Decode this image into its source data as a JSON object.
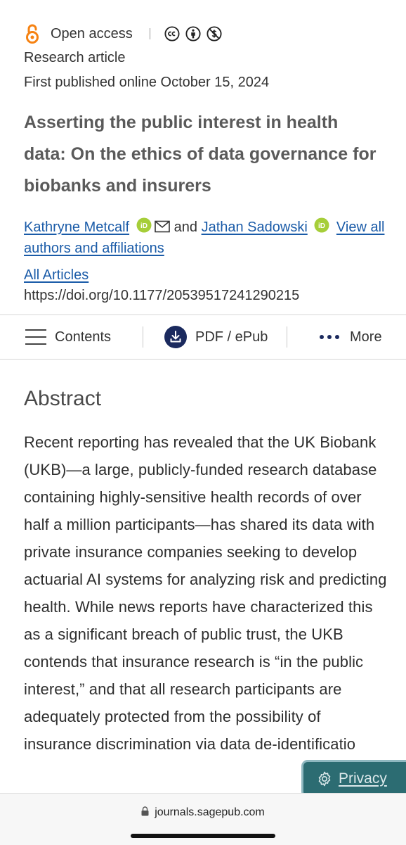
{
  "meta": {
    "access_label": "Open access",
    "license_icons": [
      "cc-icon",
      "attribution-icon",
      "noncommercial-icon"
    ],
    "article_type": "Research article",
    "published": "First published online October 15, 2024"
  },
  "article": {
    "title": "Asserting the public interest in health data: On the ethics of data governance for biobanks and insurers",
    "authors": [
      {
        "name": "Kathryne Metcalf"
      },
      {
        "name": "Jathan Sadowski"
      }
    ],
    "and_word": "and",
    "view_all_label": "View all authors and affiliations",
    "all_articles_label": "All Articles",
    "doi": "https://doi.org/10.1177/20539517241290215"
  },
  "toolbar": {
    "contents_label": "Contents",
    "pdf_label": "PDF / ePub",
    "more_label": "More"
  },
  "abstract": {
    "heading": "Abstract",
    "text": "Recent reporting has revealed that the UK Biobank (UKB)—a large, publicly-funded research database containing highly-sensitive health records of over half a million participants—has shared its data with private insurance companies seeking to develop actuarial AI systems for analyzing risk and predicting health. While news reports have characterized this as a significant breach of public trust, the UKB contends that insurance research is “in the public interest,” and that all research participants are adequately protected from the possibility of insurance discrimination via data de-identificatio"
  },
  "privacy": {
    "label": "Privacy"
  },
  "browser": {
    "url": "journals.sagepub.com"
  },
  "colors": {
    "link": "#1a5ba8",
    "open_access_orange": "#f68212",
    "orcid_green": "#a6ce39",
    "pdf_icon_navy": "#1b2a5e",
    "privacy_teal": "#2c6c72"
  }
}
